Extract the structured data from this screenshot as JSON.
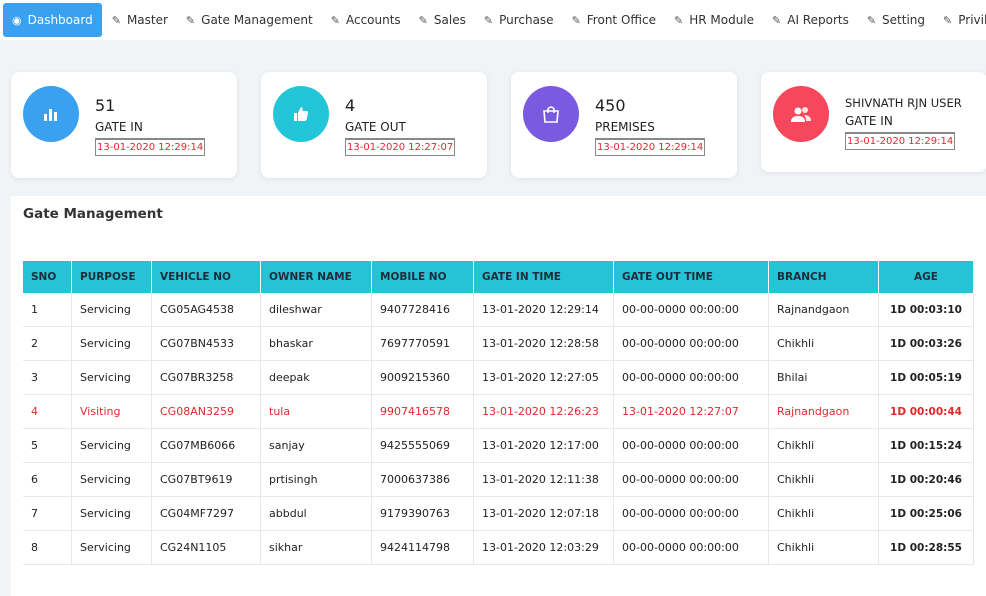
{
  "nav": {
    "items": [
      {
        "label": "Dashboard",
        "icon": "dashboard-icon",
        "active": true
      },
      {
        "label": "Master",
        "icon": "edit-icon"
      },
      {
        "label": "Gate Management",
        "icon": "edit-icon"
      },
      {
        "label": "Accounts",
        "icon": "edit-icon"
      },
      {
        "label": "Sales",
        "icon": "edit-icon"
      },
      {
        "label": "Purchase",
        "icon": "edit-icon"
      },
      {
        "label": "Front Office",
        "icon": "edit-icon"
      },
      {
        "label": "HR Module",
        "icon": "edit-icon"
      },
      {
        "label": "AI Reports",
        "icon": "edit-icon"
      },
      {
        "label": "Setting",
        "icon": "edit-icon"
      },
      {
        "label": "Privileg",
        "icon": "edit-icon"
      }
    ]
  },
  "cards": [
    {
      "count": "51",
      "label": "GATE IN",
      "timestamp": "13-01-2020 12:29:14",
      "color": "#3aa1f0",
      "icon": "bar-chart-icon"
    },
    {
      "count": "4",
      "label": "GATE OUT",
      "timestamp": "13-01-2020 12:27:07",
      "color": "#22c6d8",
      "icon": "thumbs-up-icon"
    },
    {
      "count": "450",
      "label": "PREMISES",
      "timestamp": "13-01-2020 12:29:14",
      "color": "#7a5ae0",
      "icon": "shopping-bag-icon"
    }
  ],
  "user_card": {
    "name": "SHIVNATH RJN USER",
    "label": "GATE IN",
    "timestamp": "13-01-2020 12:29:14",
    "color": "#f7475c",
    "icon": "users-icon"
  },
  "panel": {
    "title": "Gate Management"
  },
  "table": {
    "headers": [
      "SNO",
      "PURPOSE",
      "VEHICLE NO",
      "OWNER NAME",
      "MOBILE NO",
      "GATE IN TIME",
      "GATE OUT TIME",
      "BRANCH",
      "AGE"
    ],
    "rows": [
      {
        "sno": "1",
        "purpose": "Servicing",
        "vehicle": "CG05AG4538",
        "owner": "dileshwar",
        "mobile": "9407728416",
        "gate_in": "13-01-2020 12:29:14",
        "gate_out": "00-00-0000 00:00:00",
        "branch": "Rajnandgaon",
        "age": "1D 00:03:10"
      },
      {
        "sno": "2",
        "purpose": "Servicing",
        "vehicle": "CG07BN4533",
        "owner": "bhaskar",
        "mobile": "7697770591",
        "gate_in": "13-01-2020 12:28:58",
        "gate_out": "00-00-0000 00:00:00",
        "branch": "Chikhli",
        "age": "1D 00:03:26"
      },
      {
        "sno": "3",
        "purpose": "Servicing",
        "vehicle": "CG07BR3258",
        "owner": "deepak",
        "mobile": "9009215360",
        "gate_in": "13-01-2020 12:27:05",
        "gate_out": "00-00-0000 00:00:00",
        "branch": "Bhilai",
        "age": "1D 00:05:19"
      },
      {
        "sno": "4",
        "purpose": "Visiting",
        "vehicle": "CG08AN3259",
        "owner": "tula",
        "mobile": "9907416578",
        "gate_in": "13-01-2020 12:26:23",
        "gate_out": "13-01-2020 12:27:07",
        "branch": "Rajnandgaon",
        "age": "1D 00:00:44"
      },
      {
        "sno": "5",
        "purpose": "Servicing",
        "vehicle": "CG07MB6066",
        "owner": "sanjay",
        "mobile": "9425555069",
        "gate_in": "13-01-2020 12:17:00",
        "gate_out": "00-00-0000 00:00:00",
        "branch": "Chikhli",
        "age": "1D 00:15:24"
      },
      {
        "sno": "6",
        "purpose": "Servicing",
        "vehicle": "CG07BT9619",
        "owner": "prtisingh",
        "mobile": "7000637386",
        "gate_in": "13-01-2020 12:11:38",
        "gate_out": "00-00-0000 00:00:00",
        "branch": "Chikhli",
        "age": "1D 00:20:46"
      },
      {
        "sno": "7",
        "purpose": "Servicing",
        "vehicle": "CG04MF7297",
        "owner": "abbdul",
        "mobile": "9179390763",
        "gate_in": "13-01-2020 12:07:18",
        "gate_out": "00-00-0000 00:00:00",
        "branch": "Chikhli",
        "age": "1D 00:25:06"
      },
      {
        "sno": "8",
        "purpose": "Servicing",
        "vehicle": "CG24N1105",
        "owner": "sikhar",
        "mobile": "9424114798",
        "gate_in": "13-01-2020 12:03:29",
        "gate_out": "00-00-0000 00:00:00",
        "branch": "Chikhli",
        "age": "1D 00:28:55"
      }
    ]
  }
}
